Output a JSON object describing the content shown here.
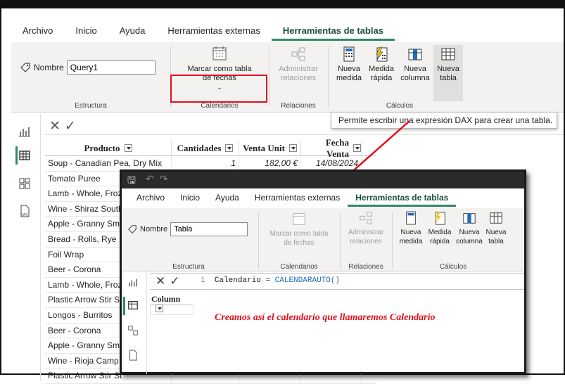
{
  "menu": [
    "Archivo",
    "Inicio",
    "Ayuda",
    "Herramientas externas",
    "Herramientas de tablas"
  ],
  "ribbon": {
    "name_label": "Nombre",
    "name_value": "Query1",
    "group_estructura": "Estructura",
    "mark_date_table": "Marcar como tabla de fechas",
    "group_calendarios": "Calendarios",
    "manage_relations": "Administrar relaciones",
    "group_relaciones": "Relaciones",
    "new_measure": "Nueva medida",
    "quick_measure": "Medida rápida",
    "new_column": "Nueva columna",
    "new_table": "Nueva tabla",
    "group_calculos": "Cálculos"
  },
  "tooltip": "Permite escribir una expresión DAX para crear una tabla.",
  "table": {
    "headers": [
      "Producto",
      "Cantidades",
      "Venta Unit",
      "Fecha Venta"
    ],
    "first_row": {
      "producto": "Soup - Canadian Pea, Dry Mix",
      "cantidad": "1",
      "venta": "182,00 €",
      "fecha": "14/08/2024"
    },
    "products": [
      "Tomato Puree",
      "Lamb - Whole, Froz",
      "Wine - Shiraz South",
      "Apple - Granny Sm",
      "Bread - Rolls, Rye",
      "Foil Wrap",
      "Beer - Corona",
      "Lamb - Whole, Froz",
      "Plastic Arrow Stir St",
      "Longos - Burritos",
      "Beer - Corona",
      "Apple - Granny Sm",
      "Wine - Rioja Camp",
      "Plastic Arrow Stir St"
    ]
  },
  "overlay": {
    "menu": [
      "Archivo",
      "Inicio",
      "Ayuda",
      "Herramientas externas",
      "Herramientas de tablas"
    ],
    "name_label": "Nombre",
    "name_value": "Tabla",
    "mark_date_table": "Marcar como tabla de fechas",
    "group_estructura": "Estructura",
    "group_calendarios": "Calendarios",
    "manage_relations": "Administrar relaciones",
    "group_relaciones": "Relaciones",
    "new_measure": "Nueva medida",
    "quick_measure": "Medida rápida",
    "new_column": "Nueva columna",
    "new_table": "Nueva tabla",
    "group_calculos": "Cálculos",
    "formula_line": "1",
    "formula_name": "Calendario",
    "formula_eq": "=",
    "formula_fn": "CALENDARAUTO",
    "formula_paren": "()",
    "column_header": "Column",
    "caption": "Creamos así el calendario que llamaremos Calendario"
  },
  "colors": {
    "accent": "#2f8a66",
    "highlight": "#e3101d"
  }
}
